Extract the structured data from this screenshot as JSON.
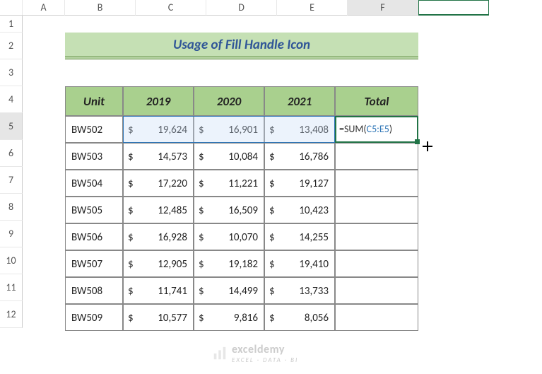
{
  "columns": [
    "",
    "A",
    "B",
    "C",
    "D",
    "E",
    "F"
  ],
  "active_col": "F",
  "active_row": "5",
  "rows": [
    "1",
    "2",
    "3",
    "4",
    "5",
    "6",
    "7",
    "8",
    "9",
    "10",
    "11",
    "12"
  ],
  "title": "Usage of Fill Handle Icon",
  "headers": {
    "unit": "Unit",
    "y2019": "2019",
    "y2020": "2020",
    "y2021": "2021",
    "total": "Total"
  },
  "formula": {
    "prefix": "=SUM(",
    "range": "C5:E5",
    "suffix": ")"
  },
  "chart_data": {
    "type": "table",
    "columns": [
      "Unit",
      "2019",
      "2020",
      "2021"
    ],
    "rows": [
      {
        "unit": "BW502",
        "y2019": 19624,
        "y2020": 16901,
        "y2021": 13408
      },
      {
        "unit": "BW503",
        "y2019": 14573,
        "y2020": 10084,
        "y2021": 16786
      },
      {
        "unit": "BW504",
        "y2019": 17220,
        "y2020": 11221,
        "y2021": 19127
      },
      {
        "unit": "BW505",
        "y2019": 12485,
        "y2020": 16509,
        "y2021": 10423
      },
      {
        "unit": "BW506",
        "y2019": 16928,
        "y2020": 10070,
        "y2021": 14255
      },
      {
        "unit": "BW507",
        "y2019": 12905,
        "y2020": 19182,
        "y2021": 19410
      },
      {
        "unit": "BW508",
        "y2019": 11741,
        "y2020": 14499,
        "y2021": 13733
      },
      {
        "unit": "BW509",
        "y2019": 10577,
        "y2020": 9816,
        "y2021": 8056
      }
    ],
    "currency": "$",
    "title": "Usage of Fill Handle Icon"
  },
  "display": {
    "rows": [
      {
        "unit": "BW502",
        "y2019": "19,624",
        "y2020": "16,901",
        "y2021": "13,408"
      },
      {
        "unit": "BW503",
        "y2019": "14,573",
        "y2020": "10,084",
        "y2021": "16,786"
      },
      {
        "unit": "BW504",
        "y2019": "17,220",
        "y2020": "11,221",
        "y2021": "19,127"
      },
      {
        "unit": "BW505",
        "y2019": "12,485",
        "y2020": "16,509",
        "y2021": "10,423"
      },
      {
        "unit": "BW506",
        "y2019": "16,928",
        "y2020": "10,070",
        "y2021": "14,255"
      },
      {
        "unit": "BW507",
        "y2019": "12,905",
        "y2020": "19,182",
        "y2021": "19,410"
      },
      {
        "unit": "BW508",
        "y2019": "11,741",
        "y2020": "14,499",
        "y2021": "13,733"
      },
      {
        "unit": "BW509",
        "y2019": "10,577",
        "y2020": "9,816",
        "y2021": "8,056"
      }
    ]
  },
  "watermark": {
    "main": "exceldemy",
    "sub": "EXCEL · DATA · BI"
  }
}
